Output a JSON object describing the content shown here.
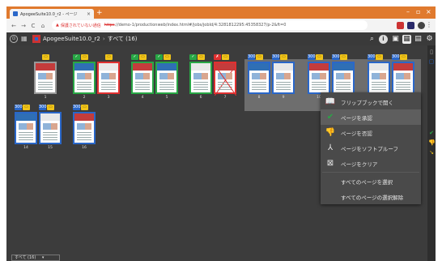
{
  "browser": {
    "tab_title": "ApogeeSuite10.0_r2 - ページ",
    "tab_close": "×",
    "new_tab": "+",
    "win_min": "–",
    "win_max": "▫",
    "win_close": "×",
    "nav_back": "←",
    "nav_forward": "→",
    "nav_reload": "C",
    "nav_home": "⌂",
    "warning_icon": "▲",
    "insecure_label": "保護されていない通信",
    "url_scheme": "https",
    "url_rest": "://demo-1/productionweb/index.html#/jobs/jobId/4:3281812295:45358327/p-2&ft=0",
    "menu": "⋮"
  },
  "toolbar": {
    "nav_icon": "⊙",
    "grid_icon": "▦",
    "doc_title": "ApogeeSuite10.0_r2",
    "separator": "›",
    "all_pages": "すべて (16)",
    "search": "⌕",
    "info": "i",
    "view_single": "▣",
    "view_grid": "▦",
    "view_book": "▤",
    "settings": "⚙"
  },
  "pages": [
    {
      "num": "1",
      "status": "none",
      "badge": ""
    },
    {
      "num": "2",
      "status": "ok",
      "badge": "✓"
    },
    {
      "num": "3",
      "status": "ng",
      "badge": ""
    },
    {
      "num": "4",
      "status": "ok",
      "badge": "✓"
    },
    {
      "num": "5",
      "status": "ok",
      "badge": "✓"
    },
    {
      "num": "6",
      "status": "ok",
      "badge": "✓"
    },
    {
      "num": "7",
      "status": "ng",
      "badge": "✗"
    },
    {
      "num": "8",
      "status": "blue",
      "badge": "300"
    },
    {
      "num": "9",
      "status": "blue",
      "badge": "300"
    },
    {
      "num": "10",
      "status": "blue",
      "badge": "300"
    },
    {
      "num": "11",
      "status": "blue",
      "badge": "300"
    },
    {
      "num": "12",
      "status": "blue",
      "badge": "300"
    },
    {
      "num": "13",
      "status": "blue",
      "badge": "300"
    },
    {
      "num": "14",
      "status": "blue",
      "badge": "300"
    },
    {
      "num": "15",
      "status": "blue",
      "badge": "300"
    },
    {
      "num": "16",
      "status": "blue",
      "badge": "300"
    }
  ],
  "context_menu": {
    "items": [
      {
        "label": "フリップブックで開く",
        "icon": "flipbook-icon",
        "glyph": "📖",
        "color": "#e6e6e6"
      },
      {
        "label": "ページを承認",
        "icon": "approve-icon",
        "glyph": "✔",
        "color": "#28a745"
      },
      {
        "label": "ページを否認",
        "icon": "reject-icon",
        "glyph": "👎",
        "color": "#e03030"
      },
      {
        "label": "ページをソフトプルーフ",
        "icon": "softproof-icon",
        "glyph": "⅄",
        "color": "#e6e6e6"
      },
      {
        "label": "ページをクリア",
        "icon": "clear-icon",
        "glyph": "⊠",
        "color": "#e6e6e6"
      },
      {
        "label": "すべてのページを選択",
        "icon": "",
        "glyph": "",
        "color": ""
      },
      {
        "label": "すべてのページの選択解除",
        "icon": "",
        "glyph": "",
        "color": ""
      }
    ]
  },
  "rightbar": {
    "panel_icon": "▯",
    "panel2_icon": "▢",
    "approve_icon": "✔",
    "reject_icon": "👎",
    "arrow_icon": "↘"
  },
  "status": {
    "filter_value": "すべて (16)",
    "filter_arrow": "▾"
  },
  "colors": {
    "chrome_orange": "#e07a2e",
    "workspace": "#3c3c3c",
    "approve": "#28a745",
    "reject": "#e03030",
    "selected_border": "#2a67c9",
    "note_badge": "#f0c419"
  }
}
